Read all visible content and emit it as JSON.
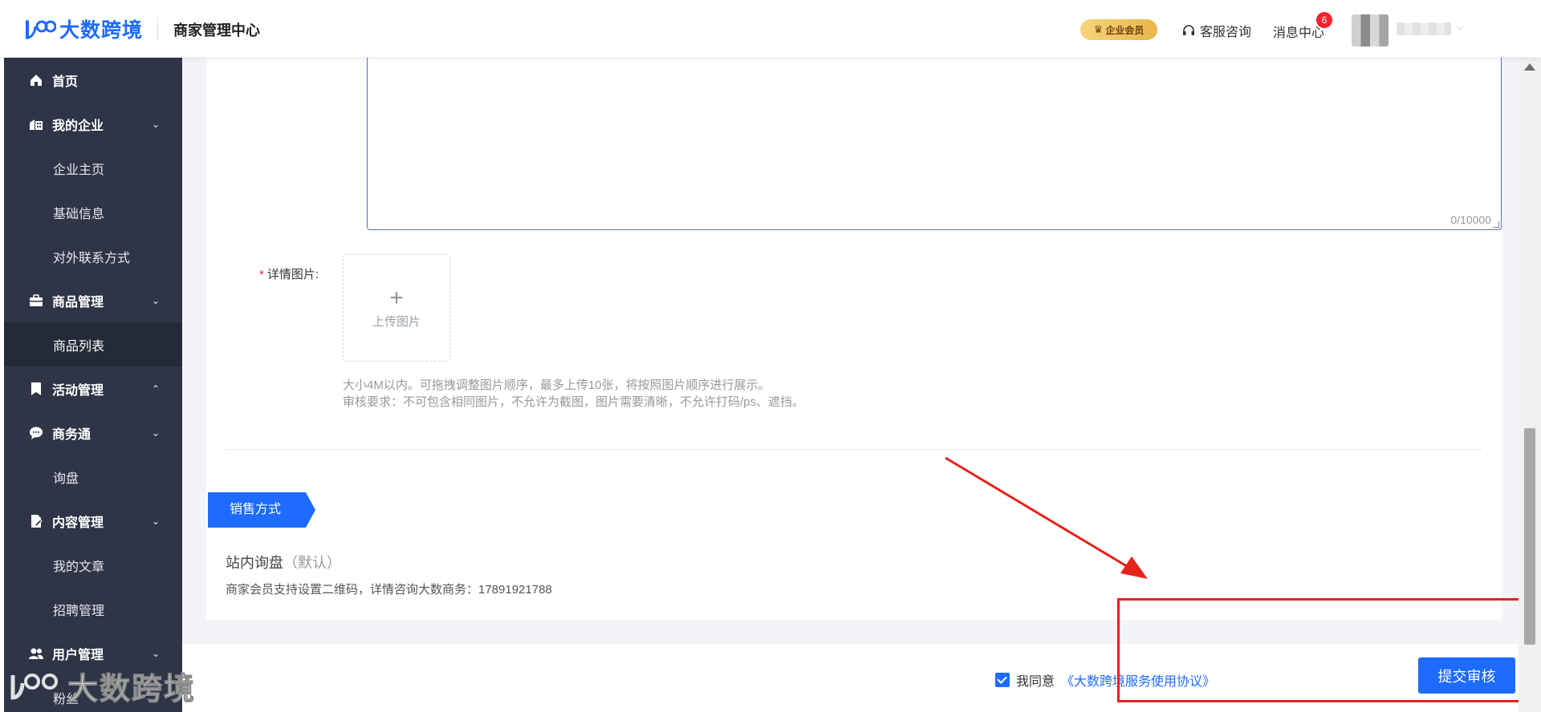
{
  "header": {
    "brand": "大数跨境",
    "title": "商家管理中心",
    "vip_badge": "企业会员",
    "service": "客服咨询",
    "messages": "消息中心",
    "message_count": "6"
  },
  "sidebar": {
    "items": [
      {
        "label": "首页",
        "icon": "home-icon"
      },
      {
        "label": "我的企业",
        "icon": "enterprise-icon"
      },
      {
        "label": "企业主页"
      },
      {
        "label": "基础信息"
      },
      {
        "label": "对外联系方式"
      },
      {
        "label": "商品管理",
        "icon": "briefcase-icon"
      },
      {
        "label": "商品列表"
      },
      {
        "label": "活动管理",
        "icon": "bookmark-icon"
      },
      {
        "label": "商务通",
        "icon": "chat-icon"
      },
      {
        "label": "询盘"
      },
      {
        "label": "内容管理",
        "icon": "edit-doc-icon"
      },
      {
        "label": "我的文章"
      },
      {
        "label": "招聘管理"
      },
      {
        "label": "用户管理",
        "icon": "users-icon"
      },
      {
        "label": "粉丝"
      }
    ]
  },
  "form": {
    "textarea_counter": "0/10000",
    "detail_images_label": "详情图片:",
    "required_mark": "*",
    "upload_label": "上传图片",
    "hint_size": "大小4M以内。可拖拽调整图片顺序，最多上传10张，将按照图片顺序进行展示。",
    "hint_review": "审核要求：不可包含相同图片，不允许为截图，图片需要清晰，不允许打码/ps、遮挡。"
  },
  "sales": {
    "section_title": "销售方式",
    "method": "站内询盘",
    "method_default": "（默认）",
    "note": "商家会员支持设置二维码，详情咨询大数商务：17891921788"
  },
  "footer": {
    "agree_text": "我同意",
    "agreement_link": "《大数跨境服务使用协议》",
    "agree_checked": true,
    "submit_label": "提交审核"
  },
  "watermark": "大数跨境",
  "colors": {
    "primary": "#1d6bff",
    "sidebar_bg": "#2f3547",
    "annotation_red": "#e5231b"
  }
}
